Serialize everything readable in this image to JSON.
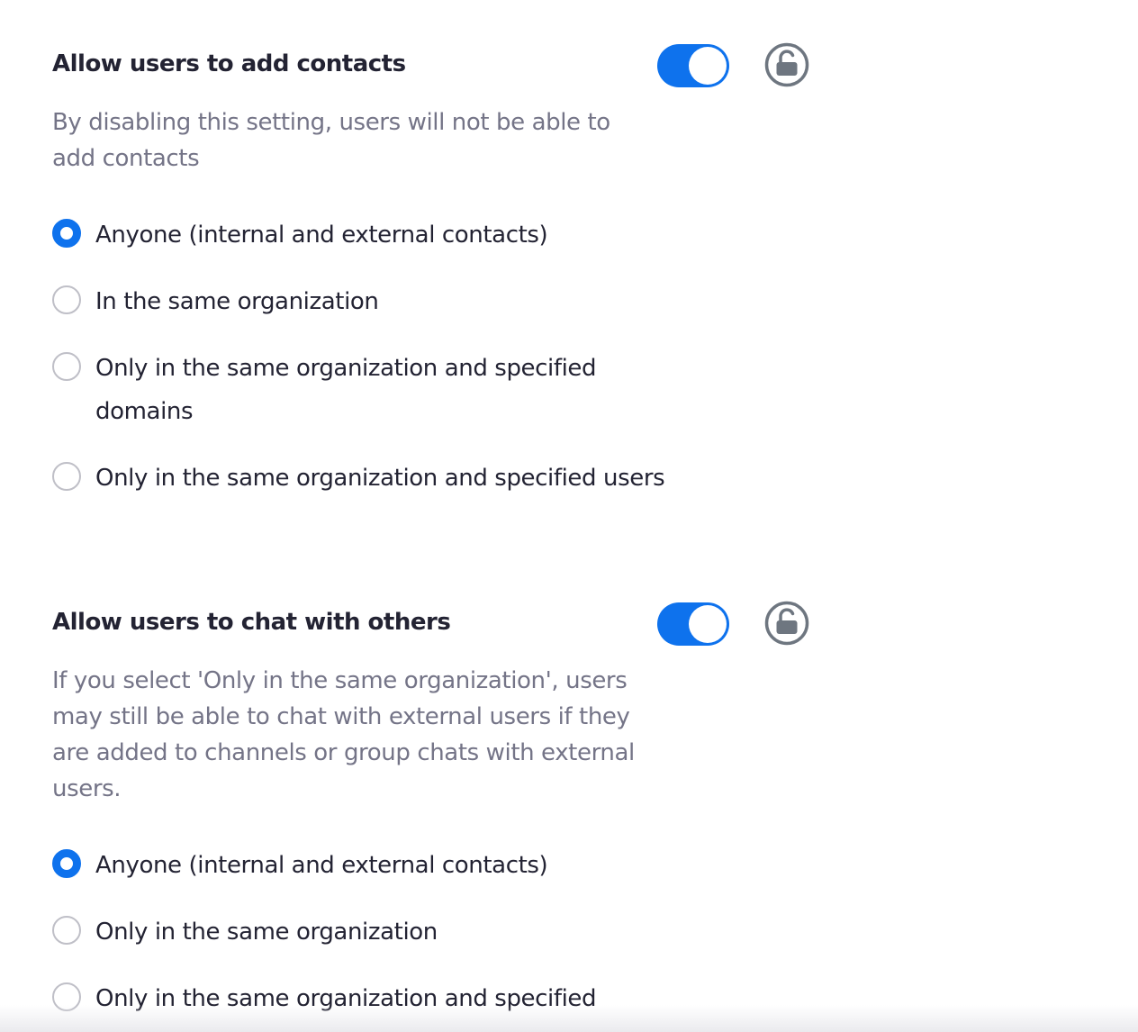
{
  "contacts": {
    "title": "Allow users to add contacts",
    "description": "By disabling this setting, users will not be able to add contacts",
    "toggle_on": true,
    "options": [
      {
        "label": "Anyone (internal and external contacts)",
        "selected": true
      },
      {
        "label": "In the same organization",
        "selected": false
      },
      {
        "label": "Only in the same organization and specified domains",
        "selected": false
      },
      {
        "label": "Only in the same organization and specified users",
        "selected": false
      }
    ]
  },
  "chat": {
    "title": "Allow users to chat with others",
    "description": "If you select 'Only in the same organization', users may still be able to chat with external users if they are added to channels or group chats with external users.",
    "toggle_on": true,
    "options": [
      {
        "label": "Anyone (internal and external contacts)",
        "selected": true
      },
      {
        "label": "Only in the same organization",
        "selected": false
      },
      {
        "label": "Only in the same organization and specified",
        "selected": false
      }
    ]
  },
  "icons": {
    "lock": "unlock-icon"
  },
  "colors": {
    "accent": "#0e72ed",
    "title": "#232333",
    "description": "#747487",
    "radio_border": "#bfbfc7"
  }
}
